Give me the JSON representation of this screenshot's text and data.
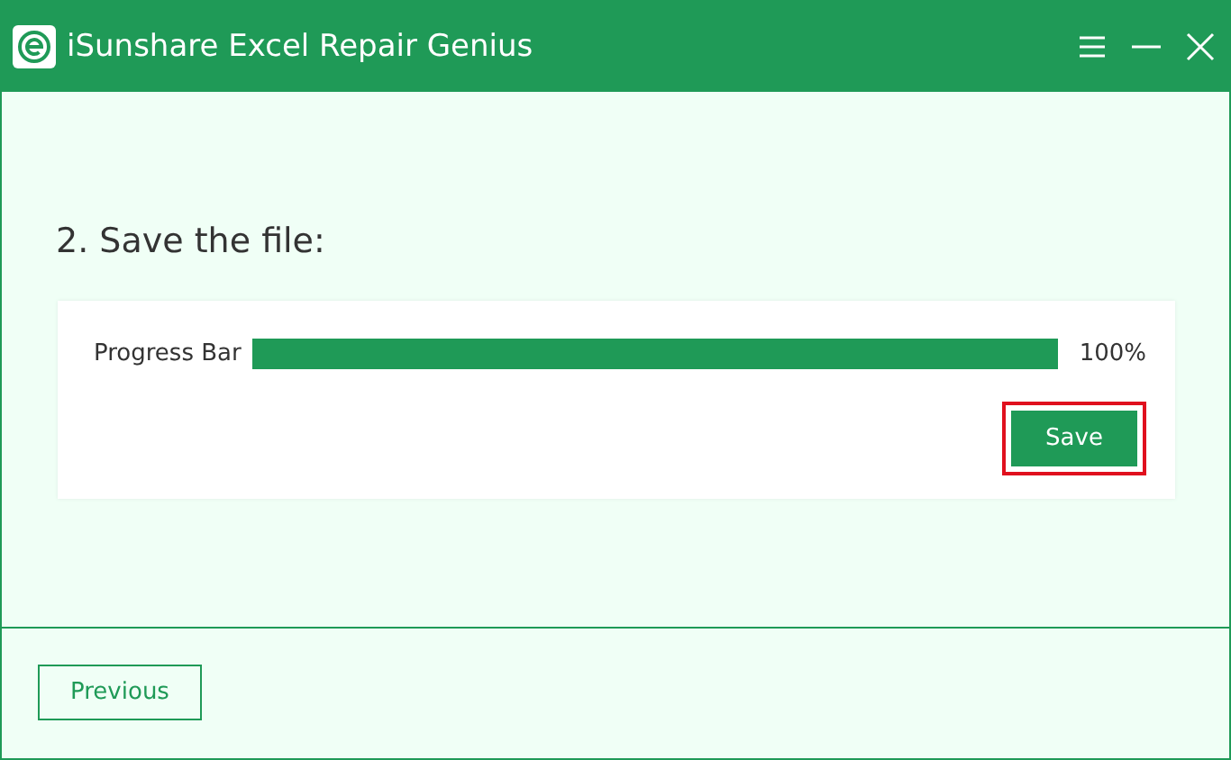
{
  "window": {
    "title": "iSunshare Excel Repair Genius",
    "controls": [
      {
        "kind": "menu"
      },
      {
        "kind": "minimize"
      },
      {
        "kind": "close"
      }
    ]
  },
  "step": {
    "heading": "2. Save the file:"
  },
  "progress": {
    "label": "Progress Bar",
    "reading": "100%"
  },
  "save_button": {
    "label": "Save",
    "highlighted": true
  },
  "footer": {
    "previous_button": "Previous"
  }
}
